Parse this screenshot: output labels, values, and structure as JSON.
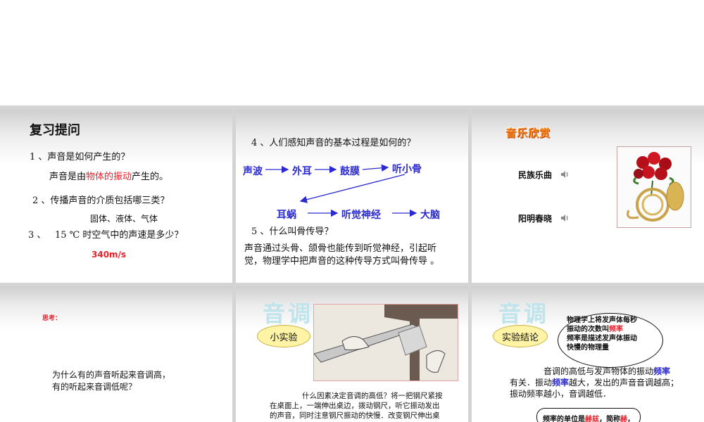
{
  "slide1": {
    "title": "复习提问",
    "q1": "1 、声音是如何产生的？",
    "a1_pre": "声音是由",
    "a1_red": "物体的振动",
    "a1_post": "产生的。",
    "q2": "2 、传播声音的介质包括哪三类？",
    "a2": "固体、液体、气体",
    "q3_num": "3 、",
    "q3": "15 ℃ 时空气中的声速是多少？",
    "a3": "340m/s"
  },
  "slide2": {
    "q4": "4 、人们感知声音的基本过程是如何的？",
    "flow": [
      "声波",
      "外耳",
      "鼓膜",
      "听小骨",
      "耳蜗",
      "听觉神经",
      "大脑"
    ],
    "q5": "5 、什么叫骨传导？",
    "a5_line1": "声音通过头骨、颌骨也能传到听觉神经，引起听",
    "a5_line2": "觉，物理学中把声音的这种传导方式叫骨传导 。"
  },
  "slide3": {
    "title": "音乐欣赏",
    "item1": "民族乐曲",
    "item2": "阳明春晓"
  },
  "slide4": {
    "label": "思考：",
    "line1": "为什么有的声音听起来音调高，",
    "line2": "有的听起来音调低呢？"
  },
  "slide5": {
    "title": "音调",
    "oval": "小实验",
    "text1": "什么因素决定音调的高低？将一把钢尺紧按",
    "text2": "在桌面上，一端伸出桌边，拨动钢尺，听它振动发出",
    "text3": "的声音，同时注意钢尺振动的快慢．改变钢尺伸出桌"
  },
  "slide6": {
    "title": "音调",
    "oval": "实验结论",
    "bubble1": "物理学上将发声体每秒",
    "bubble2_pre": "振动的次数叫",
    "bubble2_red": "频率",
    "bubble3": "频率是描述发声体振动",
    "bubble4": "快慢的物理量",
    "body1_pre": "音调的高低与发声物体的振动",
    "body1_blue": "频率",
    "body2_pre": "有关．振动",
    "body2_blue": "频率",
    "body2_post": "越大，发出的声音音调越高；",
    "body3": "振动频率越小，音调越低．",
    "unit_pre": "频率的单位是",
    "unit_red": "赫兹",
    "unit_mid": "，简称",
    "unit_red2": "赫",
    "unit_post": "，"
  },
  "colors": {
    "accent_red": "#e8202a",
    "accent_blue": "#2a2ad0",
    "oval_fill": "#fff3a6",
    "title_faint": "#bfe4ec"
  }
}
